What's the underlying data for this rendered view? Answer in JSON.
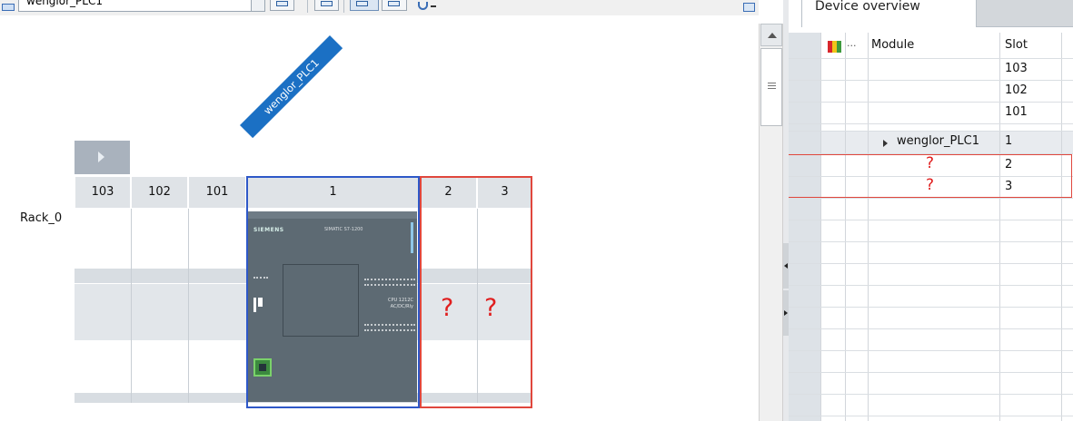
{
  "toolbar": {
    "device_name": "wenglor_PLC1"
  },
  "canvas": {
    "device_label": "wenglor_PLC1",
    "rack_name": "Rack_0",
    "slots": [
      "103",
      "102",
      "101",
      "1",
      "2",
      "3"
    ],
    "plc": {
      "brand": "SIEMENS",
      "family": "SIMATIC S7-1200",
      "cpu_line1": "CPU 1212C",
      "cpu_line2": "AC/DC/Rly"
    },
    "unknown_marker": "?"
  },
  "overview": {
    "tab_label": "Device overview",
    "columns": {
      "ellipsis": "...",
      "module": "Module",
      "slot": "Slot"
    },
    "rows": [
      {
        "module": "",
        "slot": "103"
      },
      {
        "module": "",
        "slot": "102"
      },
      {
        "module": "",
        "slot": "101"
      },
      {
        "module": "wenglor_PLC1",
        "slot": "1"
      },
      {
        "module": "?",
        "slot": "2"
      },
      {
        "module": "?",
        "slot": "3"
      }
    ]
  },
  "colors": {
    "selection_blue": "#2e58c8",
    "attention_red": "#e0473d",
    "device_label_blue": "#1b70c4",
    "plc_body": "#5d6a73",
    "question_mark": "#e01e1e"
  },
  "icons": {
    "filter_icon": "colored-bars-icon",
    "expand_icon": "triangle-right-icon",
    "scroll_up_icon": "triangle-up-icon"
  }
}
